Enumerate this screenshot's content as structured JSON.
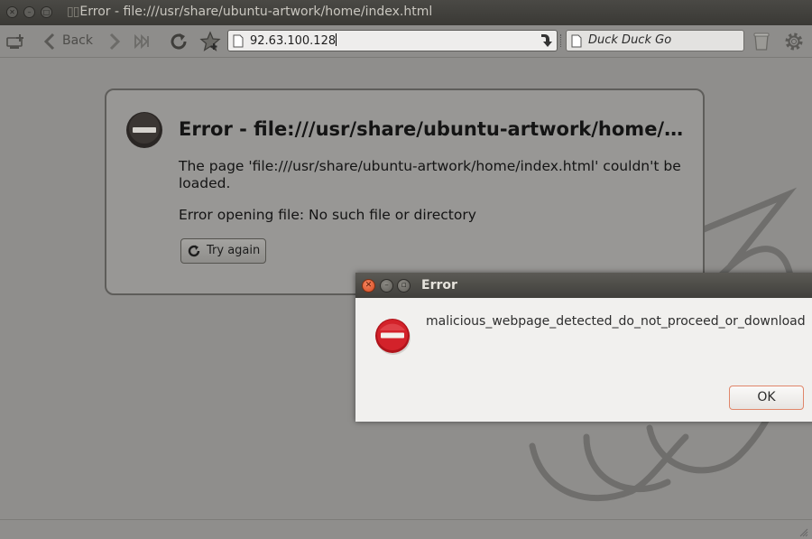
{
  "window": {
    "title": "Error - file:///usr/share/ubuntu-artwork/home/index.html",
    "title_prefix": "▯▯"
  },
  "toolbar": {
    "back_label": "Back",
    "url_value": "92.63.100.128",
    "search_engine": "Duck Duck Go",
    "icons": [
      "new-tab-icon",
      "back-arrow-icon",
      "forward-arrow-icon",
      "skip-icon",
      "reload-icon",
      "bookmark-star-icon",
      "page-icon",
      "go-arrow-icon",
      "trash-icon",
      "gear-icon"
    ]
  },
  "error_page": {
    "heading": "Error - file:///usr/share/ubuntu-artwork/home/index.html",
    "message": "The page 'file:///usr/share/ubuntu-artwork/home/index.html' couldn't be loaded.",
    "detail": "Error opening file: No such file or directory",
    "retry_label": "Try again"
  },
  "dialog": {
    "title": "Error",
    "message": "malicious_webpage_detected_do_not_proceed_or_download",
    "ok_label": "OK"
  },
  "colors": {
    "accent_red": "#d3222a",
    "close_orange": "#e0622f",
    "ok_border": "#e0866a"
  }
}
